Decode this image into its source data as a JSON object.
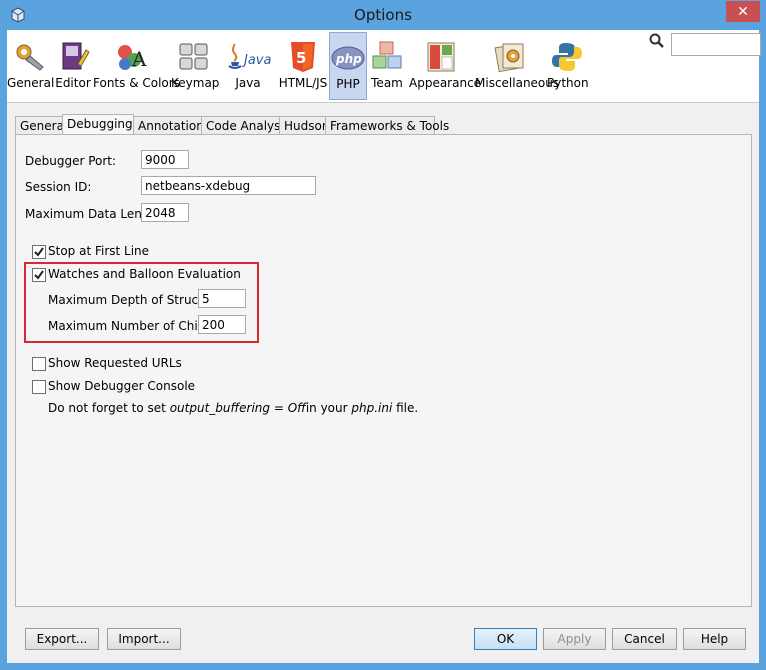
{
  "window": {
    "title": "Options",
    "close_glyph": "✕"
  },
  "categories": [
    {
      "label": "General",
      "icon": "gear-wrench-icon"
    },
    {
      "label": "Editor",
      "icon": "editor-book-icon"
    },
    {
      "label": "Fonts & Colors",
      "icon": "fonts-colors-icon"
    },
    {
      "label": "Keymap",
      "icon": "keyboard-icon"
    },
    {
      "label": "Java",
      "icon": "java-icon"
    },
    {
      "label": "HTML/JS",
      "icon": "html5-icon"
    },
    {
      "label": "PHP",
      "icon": "php-icon",
      "selected": true
    },
    {
      "label": "Team",
      "icon": "team-cubes-icon"
    },
    {
      "label": "Appearance",
      "icon": "appearance-icon"
    },
    {
      "label": "Miscellaneous",
      "icon": "miscellaneous-icon"
    },
    {
      "label": "Python",
      "icon": "python-icon"
    }
  ],
  "search": {
    "value": "",
    "icon": "magnifier-icon"
  },
  "tabs": [
    {
      "label": "General"
    },
    {
      "label": "Debugging",
      "active": true
    },
    {
      "label": "Annotations"
    },
    {
      "label": "Code Analysis"
    },
    {
      "label": "Hudson"
    },
    {
      "label": "Frameworks & Tools"
    }
  ],
  "debugging": {
    "port_label": "Debugger Port:",
    "port_value": "9000",
    "session_label": "Session ID:",
    "session_value": "netbeans-xdebug",
    "max_length_label": "Maximum Data Length:",
    "max_length_value": "2048",
    "stop_first_line_label": "Stop at First Line",
    "stop_first_line_checked": true,
    "watches_label": "Watches and Balloon Evaluation",
    "watches_checked": true,
    "max_depth_label": "Maximum Depth of Structures:",
    "max_depth_value": "5",
    "max_children_label": "Maximum Number of Children:",
    "max_children_value": "200",
    "show_urls_label": "Show Requested URLs",
    "show_urls_checked": false,
    "show_console_label": "Show Debugger Console",
    "show_console_checked": false,
    "note_prefix": "Do not forget to set ",
    "note_setting": "output_buffering = Off",
    "note_middle": "in your ",
    "note_file": "php.ini",
    "note_suffix": " file."
  },
  "footer": {
    "export_label": "Export...",
    "import_label": "Import...",
    "ok_label": "OK",
    "apply_label": "Apply",
    "cancel_label": "Cancel",
    "help_label": "Help"
  },
  "colors": {
    "title_bar": "#5aa3de",
    "highlight_box": "#d9282f",
    "selected_category": "#c8d7ef"
  }
}
